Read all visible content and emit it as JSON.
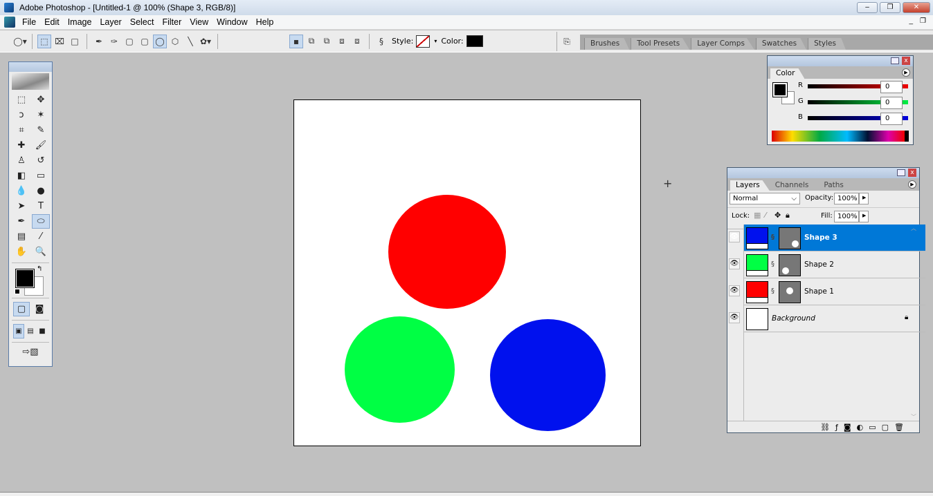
{
  "window": {
    "title": "Adobe Photoshop - [Untitled-1 @ 100% (Shape 3, RGB/8)]",
    "minimize": "–",
    "maximize": "❐",
    "close": "✕",
    "doc_min": "_",
    "doc_restore": "❐"
  },
  "menu": [
    "File",
    "Edit",
    "Image",
    "Layer",
    "Select",
    "Filter",
    "View",
    "Window",
    "Help"
  ],
  "options": {
    "style_label": "Style:",
    "color_label": "Color:",
    "color": "#000000"
  },
  "well_tabs": [
    "Brushes",
    "Tool Presets",
    "Layer Comps",
    "Swatches",
    "Styles"
  ],
  "toolbox": {
    "tools": [
      {
        "name": "rect-marquee",
        "glyph": "⬚"
      },
      {
        "name": "move",
        "glyph": "✥"
      },
      {
        "name": "lasso",
        "glyph": "ↄ"
      },
      {
        "name": "magic-wand",
        "glyph": "✶"
      },
      {
        "name": "crop",
        "glyph": "⌗"
      },
      {
        "name": "slice",
        "glyph": "✎"
      },
      {
        "name": "healing-brush",
        "glyph": "✚"
      },
      {
        "name": "brush",
        "glyph": "🖌"
      },
      {
        "name": "clone-stamp",
        "glyph": "♙"
      },
      {
        "name": "history-brush",
        "glyph": "↺"
      },
      {
        "name": "eraser",
        "glyph": "◧"
      },
      {
        "name": "gradient",
        "glyph": "▭"
      },
      {
        "name": "blur",
        "glyph": "💧"
      },
      {
        "name": "dodge",
        "glyph": "●"
      },
      {
        "name": "path-selection",
        "glyph": "➤"
      },
      {
        "name": "type",
        "glyph": "T"
      },
      {
        "name": "pen",
        "glyph": "✒"
      },
      {
        "name": "ellipse",
        "glyph": "⬭"
      },
      {
        "name": "notes",
        "glyph": "▤"
      },
      {
        "name": "eyedropper",
        "glyph": "⁄"
      },
      {
        "name": "hand",
        "glyph": "✋"
      },
      {
        "name": "zoom",
        "glyph": "🔍"
      }
    ],
    "foreground": "#000000",
    "background": "#ffffff"
  },
  "canvas": {
    "shapes": [
      {
        "name": "Shape 1",
        "color": "#ff0000"
      },
      {
        "name": "Shape 2",
        "color": "#00ff44"
      },
      {
        "name": "Shape 3",
        "color": "#0011ee"
      }
    ]
  },
  "color_panel": {
    "tab": "Color",
    "channels": [
      {
        "label": "R",
        "value": "0"
      },
      {
        "label": "G",
        "value": "0"
      },
      {
        "label": "B",
        "value": "0"
      }
    ]
  },
  "layers_panel": {
    "tabs": [
      "Layers",
      "Channels",
      "Paths"
    ],
    "blend_mode": "Normal",
    "opacity_label": "Opacity:",
    "opacity": "100%",
    "lock_label": "Lock:",
    "fill_label": "Fill:",
    "fill": "100%",
    "layers": [
      {
        "name": "Shape 3",
        "color": "#0011ee",
        "selected": true
      },
      {
        "name": "Shape 2",
        "color": "#00ff44"
      },
      {
        "name": "Shape 1",
        "color": "#ff0000"
      },
      {
        "name": "Background",
        "color": "#ffffff"
      }
    ]
  }
}
